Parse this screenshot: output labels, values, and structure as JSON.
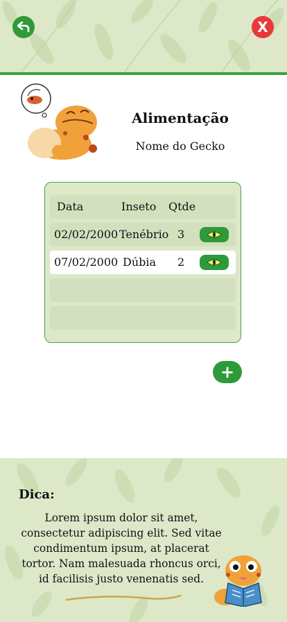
{
  "header": {
    "back_icon": "back-arrow-icon",
    "close_icon": "close-x-icon",
    "close_label": "X",
    "accent": "#2f9a3a",
    "close_color": "#e8393b"
  },
  "page": {
    "title": "Alimentação",
    "subtitle": "Nome do Gecko"
  },
  "table": {
    "headers": {
      "data": "Data",
      "inseto": "Inseto",
      "qtde": "Qtde"
    },
    "rows": [
      {
        "data": "02/02/2000",
        "inseto": "Tenébrio",
        "qtde": "3",
        "action_icon": "eye-icon"
      },
      {
        "data": "07/02/2000",
        "inseto": "Dúbia",
        "qtde": "2",
        "action_icon": "eye-icon"
      }
    ]
  },
  "actions": {
    "add_label": "+"
  },
  "tip": {
    "title": "Dica:",
    "text": "Lorem ipsum dolor sit amet, consectetur adipiscing elit. Sed vitae condimentum ipsum, at placerat tortor. Nam malesuada rhoncus orci, id facilisis justo venenatis sed."
  }
}
